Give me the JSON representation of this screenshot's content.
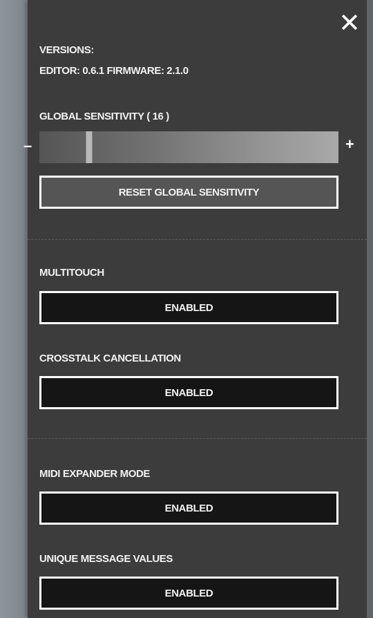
{
  "close_glyph": "✕",
  "versions": {
    "heading": "VERSIONS:",
    "line": "EDITOR: 0.6.1  FIRMWARE: 2.1.0"
  },
  "sensitivity": {
    "label": "GLOBAL SENSITIVITY ( 16 )",
    "value": 16,
    "fraction": 0.158,
    "minus": "–",
    "plus": "+",
    "reset_label": "RESET GLOBAL SENSITIVITY"
  },
  "settings": [
    {
      "label": "MULTITOUCH",
      "value": "ENABLED"
    },
    {
      "label": "CROSSTALK CANCELLATION",
      "value": "ENABLED"
    },
    {
      "label": "MIDI EXPANDER MODE",
      "value": "ENABLED"
    },
    {
      "label": "UNIQUE MESSAGE VALUES",
      "value": "ENABLED"
    }
  ],
  "colors": {
    "panel": "#3c3c3c",
    "button_dark": "#151515",
    "button_border": "#ffffff",
    "text": "#f2f2f2"
  }
}
